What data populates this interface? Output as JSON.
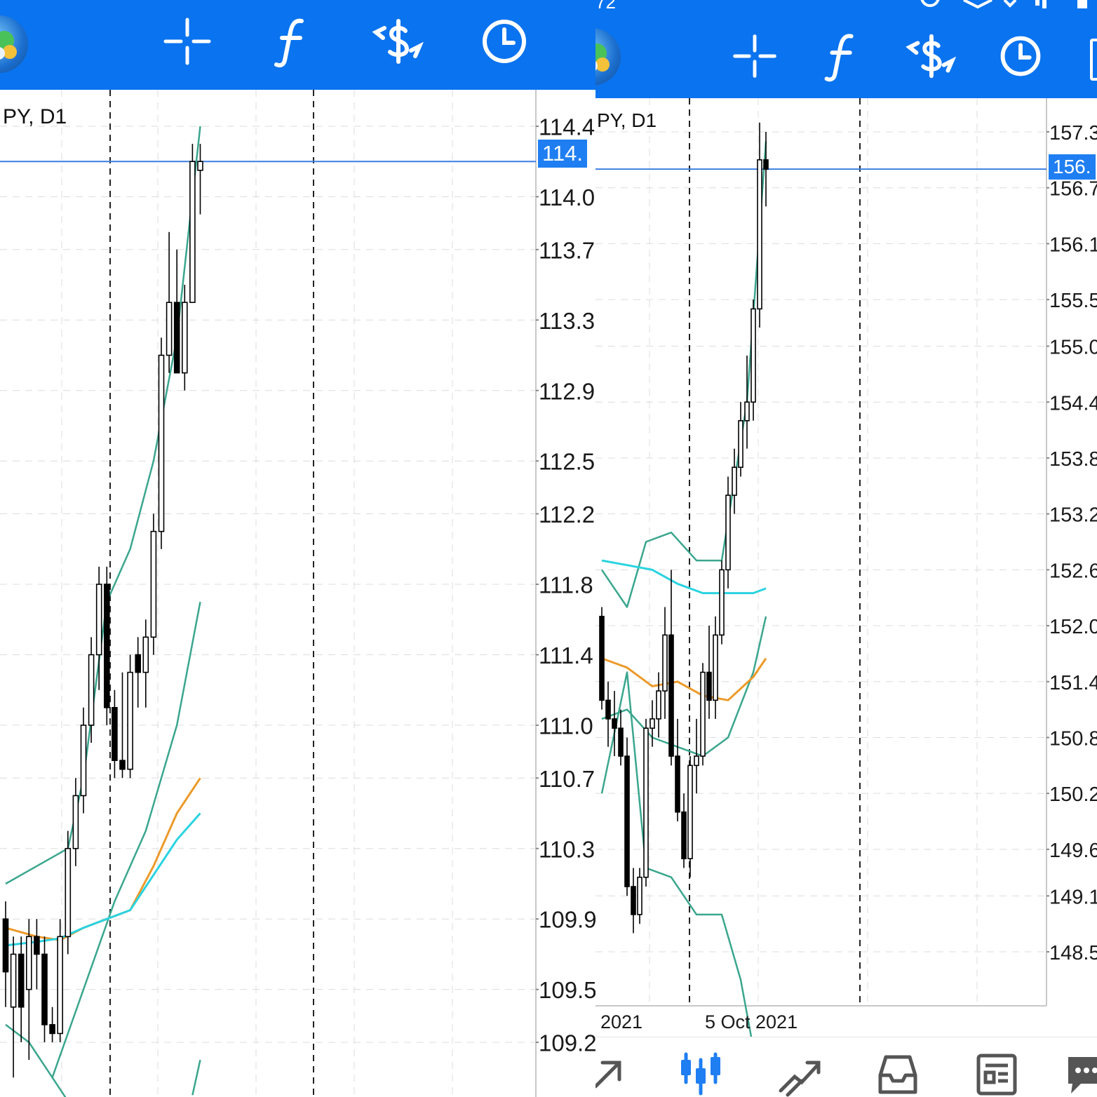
{
  "left_panel": {
    "chart_title": "PY, D1",
    "current_price_label": "114.",
    "price_axis_labels": [
      "114.4",
      "114.0",
      "113.7",
      "113.3",
      "112.9",
      "112.5",
      "112.2",
      "111.8",
      "111.4",
      "111.0",
      "110.7",
      "110.3",
      "109.9",
      "109.5",
      "109.2"
    ]
  },
  "right_panel": {
    "status_text": "72",
    "chart_title": "PY, D1",
    "current_price_label": "156.",
    "price_axis_labels": [
      "157.3",
      "156.7",
      "156.1",
      "155.5",
      "155.0",
      "154.4",
      "153.8",
      "153.2",
      "152.6",
      "152.0",
      "151.4",
      "150.8",
      "150.2",
      "149.6",
      "149.1",
      "148.5"
    ],
    "date_labels": [
      "2021",
      "5 Oct 2021"
    ]
  },
  "toolbar": {
    "icons": [
      "crosshair-icon",
      "indicator-f-icon",
      "dollar-trade-icon",
      "clock-icon"
    ]
  },
  "bottom_nav": {
    "icons": [
      "quotes-arrow-icon",
      "chart-candles-icon",
      "trade-icon",
      "history-tray-icon",
      "news-icon",
      "chat-icon"
    ]
  },
  "colors": {
    "toolbar": "#0a73ef",
    "price_line": "#3b7fe0",
    "price_tag": "#1f7ef2",
    "band": "#3aa68e",
    "ma_orange": "#ec9a2a",
    "ma_cyan": "#2ad3e0",
    "grid": "#dcdcdc"
  },
  "chart_data": [
    {
      "type": "candlestick",
      "title": "PY, D1",
      "ylim": [
        109.2,
        114.4
      ],
      "y_ticks": [
        114.4,
        114.0,
        113.7,
        113.3,
        112.9,
        112.5,
        112.2,
        111.8,
        111.4,
        111.0,
        110.7,
        110.3,
        109.9,
        109.5,
        109.2
      ],
      "current_price": 114.2,
      "candles": [
        {
          "o": 109.9,
          "h": 110.0,
          "l": 109.4,
          "c": 109.6
        },
        {
          "o": 109.4,
          "h": 109.8,
          "l": 109.0,
          "c": 109.7
        },
        {
          "o": 109.7,
          "h": 109.8,
          "l": 109.2,
          "c": 109.4
        },
        {
          "o": 109.5,
          "h": 109.9,
          "l": 109.1,
          "c": 109.8
        },
        {
          "o": 109.8,
          "h": 109.9,
          "l": 109.5,
          "c": 109.7
        },
        {
          "o": 109.7,
          "h": 109.8,
          "l": 109.2,
          "c": 109.3
        },
        {
          "o": 109.3,
          "h": 109.4,
          "l": 109.2,
          "c": 109.25
        },
        {
          "o": 109.25,
          "h": 109.9,
          "l": 109.2,
          "c": 109.8
        },
        {
          "o": 109.8,
          "h": 110.4,
          "l": 109.7,
          "c": 110.3
        },
        {
          "o": 110.3,
          "h": 110.7,
          "l": 110.2,
          "c": 110.6
        },
        {
          "o": 110.6,
          "h": 111.1,
          "l": 110.5,
          "c": 111.0
        },
        {
          "o": 111.0,
          "h": 111.5,
          "l": 110.9,
          "c": 111.4
        },
        {
          "o": 111.4,
          "h": 111.9,
          "l": 111.2,
          "c": 111.8
        },
        {
          "o": 111.8,
          "h": 111.9,
          "l": 111.0,
          "c": 111.1
        },
        {
          "o": 111.1,
          "h": 111.2,
          "l": 110.7,
          "c": 110.8
        },
        {
          "o": 110.8,
          "h": 111.3,
          "l": 110.7,
          "c": 110.75
        },
        {
          "o": 110.75,
          "h": 111.4,
          "l": 110.7,
          "c": 111.3
        },
        {
          "o": 111.4,
          "h": 111.5,
          "l": 111.1,
          "c": 111.3
        },
        {
          "o": 111.3,
          "h": 111.6,
          "l": 111.1,
          "c": 111.5
        },
        {
          "o": 111.5,
          "h": 112.2,
          "l": 111.4,
          "c": 112.1
        },
        {
          "o": 112.1,
          "h": 113.2,
          "l": 112.0,
          "c": 113.1
        },
        {
          "o": 113.1,
          "h": 113.8,
          "l": 113.0,
          "c": 113.4
        },
        {
          "o": 113.4,
          "h": 113.7,
          "l": 113.0,
          "c": 113.0
        },
        {
          "o": 113.0,
          "h": 113.5,
          "l": 112.9,
          "c": 113.4
        },
        {
          "o": 113.4,
          "h": 114.3,
          "l": 113.4,
          "c": 114.2
        },
        {
          "o": 114.15,
          "h": 114.3,
          "l": 113.9,
          "c": 114.2
        }
      ],
      "series": [
        {
          "name": "",
          "color": "#3aa68e",
          "values": [
            [
              0,
              110.1
            ],
            [
              4,
              110.2
            ],
            [
              8,
              110.3
            ],
            [
              10,
              110.7
            ],
            [
              13,
              111.7
            ],
            [
              16,
              112.0
            ],
            [
              19,
              112.5
            ],
            [
              22,
              113.2
            ],
            [
              24,
              114.0
            ],
            [
              25,
              114.4
            ]
          ]
        },
        {
          "name": "",
          "color": "#3aa68e",
          "values": [
            [
              0,
              109.3
            ],
            [
              3,
              109.2
            ],
            [
              6,
              109.0
            ],
            [
              9,
              108.8
            ],
            [
              12,
              108.6
            ]
          ]
        },
        {
          "name": "",
          "color": "#3aa68e",
          "values": [
            [
              6,
              109.0
            ],
            [
              10,
              109.5
            ],
            [
              14,
              110.0
            ],
            [
              18,
              110.4
            ],
            [
              22,
              111.0
            ],
            [
              25,
              111.7
            ]
          ]
        },
        {
          "name": "",
          "color": "#3aa68e",
          "values": [
            [
              24,
              108.9
            ],
            [
              25,
              109.1
            ]
          ]
        },
        {
          "name": "",
          "color": "#ec9a2a",
          "values": [
            [
              0,
              109.85
            ],
            [
              4,
              109.8
            ],
            [
              7,
              109.78
            ],
            [
              10,
              109.85
            ],
            [
              13,
              109.9
            ],
            [
              16,
              109.95
            ],
            [
              19,
              110.2
            ],
            [
              22,
              110.5
            ],
            [
              25,
              110.7
            ]
          ]
        },
        {
          "name": "",
          "color": "#2ad3e0",
          "values": [
            [
              0,
              109.75
            ],
            [
              4,
              109.77
            ],
            [
              7,
              109.79
            ],
            [
              10,
              109.85
            ],
            [
              13,
              109.9
            ],
            [
              16,
              109.95
            ],
            [
              19,
              110.15
            ],
            [
              22,
              110.35
            ],
            [
              25,
              110.5
            ]
          ]
        }
      ]
    },
    {
      "type": "candlestick",
      "title": "PY, D1",
      "ylim": [
        148.5,
        157.3
      ],
      "y_ticks": [
        157.3,
        156.7,
        156.1,
        155.5,
        155.0,
        154.4,
        153.8,
        153.2,
        152.6,
        152.0,
        151.4,
        150.8,
        150.2,
        149.6,
        149.1,
        148.5
      ],
      "x_labels": [
        "2021",
        "5 Oct 2021"
      ],
      "current_price": 156.9,
      "candles": [
        {
          "o": 152.1,
          "h": 152.2,
          "l": 151.1,
          "c": 151.2
        },
        {
          "o": 151.2,
          "h": 151.4,
          "l": 150.7,
          "c": 151.0
        },
        {
          "o": 151.0,
          "h": 151.3,
          "l": 150.6,
          "c": 150.9
        },
        {
          "o": 150.9,
          "h": 151.1,
          "l": 150.5,
          "c": 150.6
        },
        {
          "o": 150.6,
          "h": 150.8,
          "l": 149.1,
          "c": 149.2
        },
        {
          "o": 149.2,
          "h": 149.4,
          "l": 148.7,
          "c": 148.9
        },
        {
          "o": 148.9,
          "h": 149.4,
          "l": 148.8,
          "c": 149.3
        },
        {
          "o": 149.3,
          "h": 151.0,
          "l": 149.2,
          "c": 150.9
        },
        {
          "o": 150.9,
          "h": 151.2,
          "l": 150.7,
          "c": 151.0
        },
        {
          "o": 151.0,
          "h": 151.5,
          "l": 150.8,
          "c": 151.3
        },
        {
          "o": 151.3,
          "h": 152.2,
          "l": 151.0,
          "c": 151.9
        },
        {
          "o": 151.9,
          "h": 152.6,
          "l": 150.5,
          "c": 150.6
        },
        {
          "o": 150.6,
          "h": 151.0,
          "l": 149.9,
          "c": 150.0
        },
        {
          "o": 150.0,
          "h": 150.2,
          "l": 149.4,
          "c": 149.5
        },
        {
          "o": 149.5,
          "h": 150.6,
          "l": 149.3,
          "c": 150.5
        },
        {
          "o": 150.5,
          "h": 151.0,
          "l": 150.2,
          "c": 150.6
        },
        {
          "o": 150.6,
          "h": 151.6,
          "l": 150.5,
          "c": 151.5
        },
        {
          "o": 151.5,
          "h": 152.0,
          "l": 151.0,
          "c": 151.2
        },
        {
          "o": 151.2,
          "h": 152.1,
          "l": 151.0,
          "c": 151.9
        },
        {
          "o": 151.9,
          "h": 152.7,
          "l": 151.8,
          "c": 152.6
        },
        {
          "o": 152.6,
          "h": 153.6,
          "l": 152.4,
          "c": 153.4
        },
        {
          "o": 153.4,
          "h": 153.9,
          "l": 153.2,
          "c": 153.7
        },
        {
          "o": 153.7,
          "h": 154.4,
          "l": 153.6,
          "c": 154.2
        },
        {
          "o": 154.2,
          "h": 154.9,
          "l": 153.9,
          "c": 154.4
        },
        {
          "o": 154.4,
          "h": 155.5,
          "l": 154.2,
          "c": 155.4
        },
        {
          "o": 155.4,
          "h": 157.4,
          "l": 155.2,
          "c": 157.0
        },
        {
          "o": 157.0,
          "h": 157.3,
          "l": 156.5,
          "c": 156.9
        }
      ],
      "series": [
        {
          "name": "",
          "color": "#3aa68e",
          "values": [
            [
              0,
              152.6
            ],
            [
              4,
              152.2
            ],
            [
              7,
              152.9
            ],
            [
              11,
              153.0
            ],
            [
              15,
              152.7
            ],
            [
              19,
              152.7
            ],
            [
              23,
              154.4
            ],
            [
              26,
              157.2
            ]
          ]
        },
        {
          "name": "",
          "color": "#3aa68e",
          "values": [
            [
              0,
              150.2
            ],
            [
              4,
              151.5
            ],
            [
              7,
              149.4
            ],
            [
              11,
              149.3
            ],
            [
              15,
              148.9
            ],
            [
              19,
              148.9
            ],
            [
              22,
              148.2
            ],
            [
              25,
              147.1
            ]
          ]
        },
        {
          "name": "",
          "color": "#3aa68e",
          "values": [
            [
              0,
              151.0
            ],
            [
              4,
              151.1
            ],
            [
              8,
              150.8
            ],
            [
              12,
              150.7
            ],
            [
              16,
              150.6
            ],
            [
              20,
              150.8
            ],
            [
              24,
              151.5
            ],
            [
              26,
              152.1
            ]
          ]
        },
        {
          "name": "",
          "color": "#ec9a2a",
          "values": [
            [
              0,
              151.65
            ],
            [
              4,
              151.55
            ],
            [
              8,
              151.35
            ],
            [
              12,
              151.4
            ],
            [
              16,
              151.25
            ],
            [
              20,
              151.2
            ],
            [
              24,
              151.45
            ],
            [
              26,
              151.65
            ]
          ]
        },
        {
          "name": "",
          "color": "#2ad3e0",
          "values": [
            [
              0,
              152.7
            ],
            [
              4,
              152.65
            ],
            [
              8,
              152.6
            ],
            [
              12,
              152.45
            ],
            [
              16,
              152.35
            ],
            [
              20,
              152.35
            ],
            [
              24,
              152.35
            ],
            [
              26,
              152.4
            ]
          ]
        }
      ]
    }
  ]
}
